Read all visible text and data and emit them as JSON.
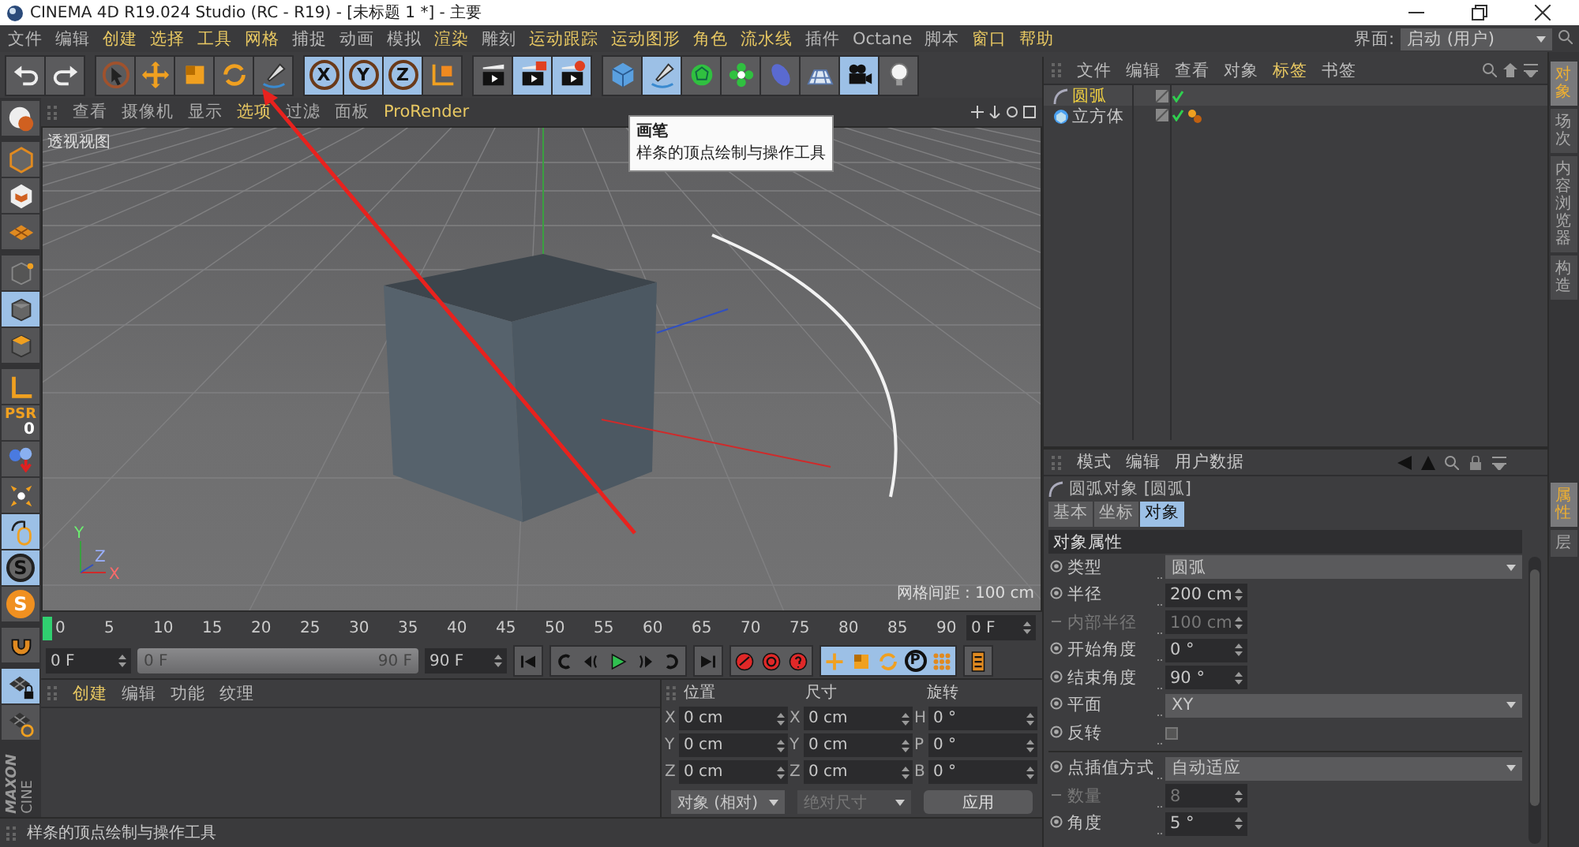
{
  "window": {
    "title": "CINEMA 4D R19.024 Studio (RC - R19) - [未标题 1 *] - 主要"
  },
  "menu": {
    "items": [
      {
        "label": "文件",
        "highlighted": false
      },
      {
        "label": "编辑",
        "highlighted": false
      },
      {
        "label": "创建",
        "highlighted": true
      },
      {
        "label": "选择",
        "highlighted": true
      },
      {
        "label": "工具",
        "highlighted": true
      },
      {
        "label": "网格",
        "highlighted": true
      },
      {
        "label": "捕捉",
        "highlighted": false
      },
      {
        "label": "动画",
        "highlighted": false
      },
      {
        "label": "模拟",
        "highlighted": false
      },
      {
        "label": "渲染",
        "highlighted": true
      },
      {
        "label": "雕刻",
        "highlighted": false
      },
      {
        "label": "运动跟踪",
        "highlighted": true
      },
      {
        "label": "运动图形",
        "highlighted": true
      },
      {
        "label": "角色",
        "highlighted": true
      },
      {
        "label": "流水线",
        "highlighted": true
      },
      {
        "label": "插件",
        "highlighted": false
      },
      {
        "label": "Octane",
        "highlighted": false
      },
      {
        "label": "脚本",
        "highlighted": false
      },
      {
        "label": "窗口",
        "highlighted": true
      },
      {
        "label": "帮助",
        "highlighted": true
      }
    ],
    "layout_selector": {
      "label": "界面:",
      "value": "启动 (用户)"
    }
  },
  "toolbar": {
    "groups": [
      [
        {
          "kind": "undo",
          "active": false
        },
        {
          "kind": "redo",
          "active": false
        }
      ],
      [
        {
          "kind": "select-tool",
          "active": false
        },
        {
          "kind": "move-tool",
          "active": false
        },
        {
          "kind": "scale-tool",
          "active": false
        },
        {
          "kind": "rotate-tool",
          "active": false
        },
        {
          "kind": "pen-tool",
          "active": false
        }
      ],
      [
        {
          "kind": "axis-lock",
          "label": "X",
          "active": true
        },
        {
          "kind": "axis-lock",
          "label": "Y",
          "active": true
        },
        {
          "kind": "axis-lock",
          "label": "Z",
          "active": true
        },
        {
          "kind": "coordinate-system",
          "active": false
        }
      ],
      [
        {
          "kind": "render-view",
          "active": false
        },
        {
          "kind": "render",
          "active": true
        },
        {
          "kind": "render-settings",
          "active": true
        }
      ],
      [
        {
          "kind": "cube",
          "active": false
        },
        {
          "kind": "pen-tool",
          "active": true
        },
        {
          "kind": "subdivision",
          "active": false
        },
        {
          "kind": "cloner",
          "active": false
        },
        {
          "kind": "deformer",
          "active": false
        },
        {
          "kind": "floor",
          "active": false
        },
        {
          "kind": "camera",
          "active": true
        },
        {
          "kind": "light",
          "active": false
        }
      ]
    ]
  },
  "left_toolbar": {
    "groups": [
      [
        {
          "kind": "make-editable",
          "active": false
        }
      ],
      [
        {
          "kind": "model-mode",
          "active": false
        },
        {
          "kind": "texture-mode",
          "active": false
        },
        {
          "kind": "workplane-mode",
          "active": false
        }
      ],
      [
        {
          "kind": "points-mode",
          "active": false
        },
        {
          "kind": "polygons-mode",
          "active": true
        },
        {
          "kind": "object-mode",
          "active": false
        }
      ],
      [
        {
          "kind": "axis-mode",
          "active": false
        },
        {
          "kind": "psr",
          "label": "PSR",
          "value": "0",
          "active": false
        },
        {
          "kind": "dynamics",
          "active": false
        },
        {
          "kind": "tweak",
          "active": false
        },
        {
          "kind": "mouse",
          "active": true
        },
        {
          "kind": "snap",
          "label": "S",
          "active": true
        },
        {
          "kind": "solo",
          "label": "S",
          "active": false
        }
      ],
      [
        {
          "kind": "magnet",
          "active": false
        }
      ],
      [
        {
          "kind": "workplane-lock",
          "active": true
        },
        {
          "kind": "workplane-align",
          "active": false
        }
      ]
    ],
    "logo": [
      "MAXON",
      "CINE"
    ]
  },
  "viewport": {
    "menu": [
      {
        "label": "查看",
        "highlighted": false
      },
      {
        "label": "摄像机",
        "highlighted": false
      },
      {
        "label": "显示",
        "highlighted": false
      },
      {
        "label": "选项",
        "highlighted": true
      },
      {
        "label": "过滤",
        "highlighted": false
      },
      {
        "label": "面板",
        "highlighted": false
      },
      {
        "label": "ProRender",
        "highlighted": true
      }
    ],
    "view_name": "透视视图",
    "grid_spacing": "网格间距 : 100 cm",
    "axis_labels": [
      "Y",
      "X",
      "Z"
    ],
    "tooltip": {
      "title": "画笔",
      "text": "样条的顶点绘制与操作工具"
    }
  },
  "timeline": {
    "ticks": [
      "0",
      "5",
      "10",
      "15",
      "20",
      "25",
      "30",
      "35",
      "40",
      "45",
      "50",
      "55",
      "60",
      "65",
      "70",
      "75",
      "80",
      "85",
      "90"
    ],
    "playhead": {
      "level": 0
    },
    "current_frame": "0 F"
  },
  "transport": {
    "start": "0 F",
    "range_start": "0 F",
    "range_end": "90 F",
    "end": "90 F",
    "range": {
      "level": 1
    },
    "buttons": [
      {
        "kind": "go-start",
        "active": false
      },
      {
        "kind": "prev-frame",
        "active": false
      },
      {
        "kind": "prev-key",
        "active": false
      },
      {
        "kind": "play",
        "active": false
      },
      {
        "kind": "next-key",
        "active": false
      },
      {
        "kind": "next-frame",
        "active": false
      },
      {
        "kind": "go-end",
        "active": false
      },
      {
        "kind": "record",
        "active": false
      },
      {
        "kind": "auto-key",
        "active": false
      },
      {
        "kind": "key-help",
        "active": false
      },
      {
        "kind": "key-position",
        "active": true
      },
      {
        "kind": "key-scale",
        "active": true
      },
      {
        "kind": "key-rotation",
        "active": true
      },
      {
        "kind": "key-parameter",
        "label": "P",
        "active": true
      },
      {
        "kind": "key-points",
        "active": true
      },
      {
        "kind": "timeline-window",
        "active": false
      }
    ]
  },
  "materials": {
    "menu": [
      {
        "label": "创建",
        "highlighted": true
      },
      {
        "label": "编辑",
        "highlighted": false
      },
      {
        "label": "功能",
        "highlighted": false
      },
      {
        "label": "纹理",
        "highlighted": false
      }
    ]
  },
  "coordinates": {
    "headers": [
      "位置",
      "尺寸",
      "旋转"
    ],
    "rows": [
      {
        "axes": [
          "X",
          "X",
          "H"
        ],
        "values": [
          "0 cm",
          "0 cm",
          "0 °"
        ]
      },
      {
        "axes": [
          "Y",
          "Y",
          "P"
        ],
        "values": [
          "0 cm",
          "0 cm",
          "0 °"
        ]
      },
      {
        "axes": [
          "Z",
          "Z",
          "B"
        ],
        "values": [
          "0 cm",
          "0 cm",
          "0 °"
        ]
      }
    ],
    "mode": "对象 (相对)",
    "size_mode": {
      "label": "绝对尺寸",
      "disabled": true
    },
    "apply": "应用"
  },
  "status_bar": "样条的顶点绘制与操作工具",
  "objects": {
    "menu": [
      {
        "label": "文件",
        "highlighted": false
      },
      {
        "label": "编辑",
        "highlighted": false
      },
      {
        "label": "查看",
        "highlighted": false
      },
      {
        "label": "对象",
        "highlighted": false
      },
      {
        "label": "标签",
        "highlighted": true
      },
      {
        "label": "书签",
        "highlighted": false
      }
    ],
    "items": [
      {
        "label": "圆弧",
        "kind": "spline",
        "selected": true,
        "tag": false
      },
      {
        "label": "立方体",
        "kind": "cube",
        "selected": false,
        "tag": true
      }
    ]
  },
  "attributes": {
    "menu": [
      "模式",
      "编辑",
      "用户数据"
    ],
    "title": "圆弧对象 [圆弧]",
    "tabs": [
      {
        "label": "基本",
        "selected": false
      },
      {
        "label": "坐标",
        "selected": false
      },
      {
        "label": "对象",
        "selected": true
      }
    ],
    "section": "对象属性",
    "groups": [
      [
        {
          "label": "类型",
          "kind": "dropdown",
          "value": "圆弧",
          "disabled": false
        },
        {
          "label": "半径",
          "kind": "number",
          "value": "200 cm",
          "disabled": false
        },
        {
          "label": "内部半径",
          "kind": "number",
          "value": "100 cm",
          "disabled": true
        },
        {
          "label": "开始角度",
          "kind": "number",
          "value": "0 °",
          "disabled": false
        },
        {
          "label": "结束角度",
          "kind": "number",
          "value": "90 °",
          "disabled": false
        },
        {
          "label": "平面",
          "kind": "dropdown",
          "value": "XY",
          "disabled": false
        },
        {
          "label": "反转",
          "kind": "checkbox",
          "checked": false,
          "disabled": false
        }
      ],
      [
        {
          "label": "点插值方式",
          "kind": "dropdown",
          "value": "自动适应",
          "disabled": false
        },
        {
          "label": "数量",
          "kind": "number",
          "value": "8",
          "disabled": true
        },
        {
          "label": "角度",
          "kind": "number",
          "value": "5 °",
          "disabled": false
        }
      ]
    ]
  },
  "side_tabs": {
    "top": [
      {
        "label": "对象",
        "selected": true
      },
      {
        "label": "场次",
        "selected": false
      },
      {
        "label": "内容浏览器",
        "selected": false
      },
      {
        "label": "构造",
        "selected": false
      }
    ],
    "bottom": [
      {
        "label": "属性",
        "selected": true
      },
      {
        "label": "层",
        "selected": false
      }
    ]
  }
}
